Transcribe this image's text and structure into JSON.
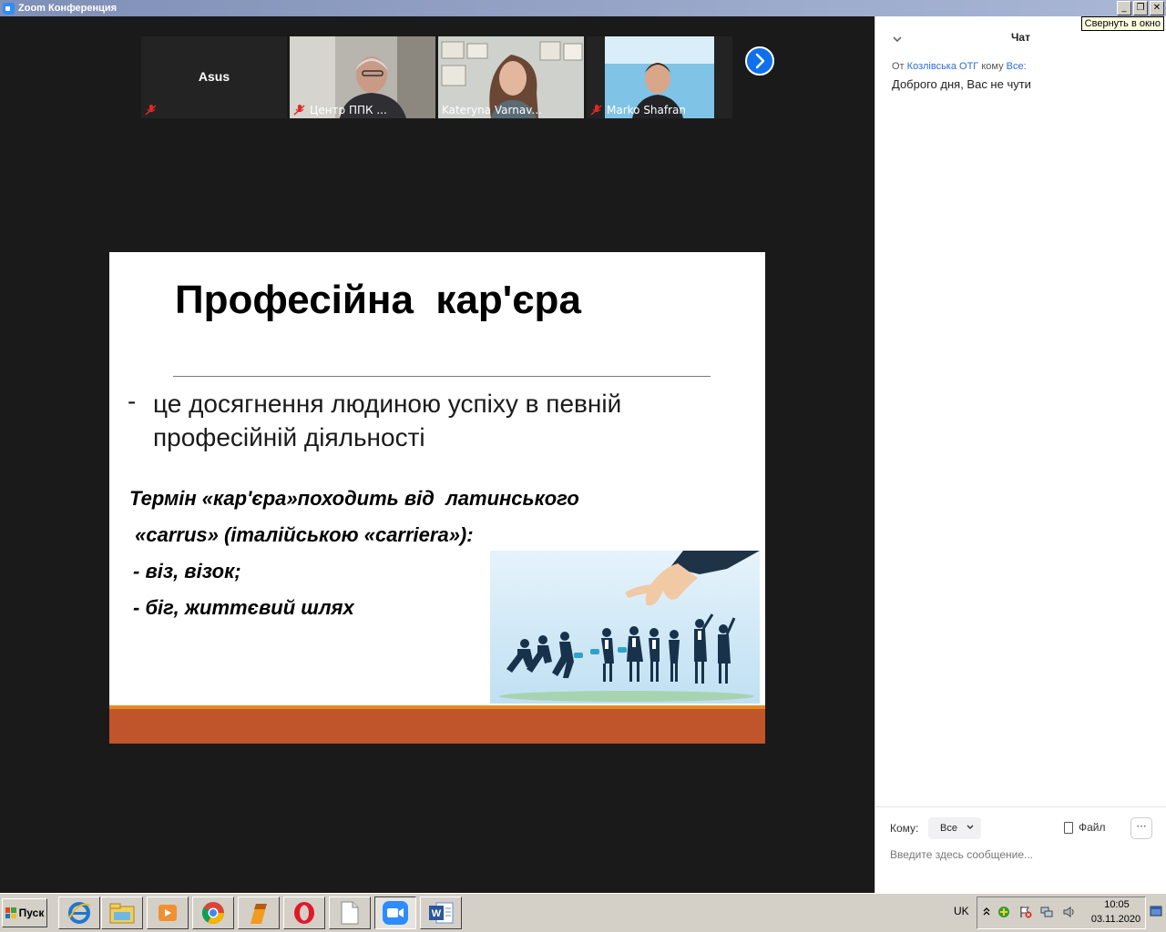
{
  "window": {
    "title": "Zoom Конференция",
    "tooltip": "Свернуть в окно",
    "buttons": [
      "minimize",
      "restore",
      "close"
    ]
  },
  "participants": [
    {
      "name": "Asus",
      "muted": true,
      "video": false
    },
    {
      "name": "Центр ППК ...",
      "muted": true,
      "video": true
    },
    {
      "name": "Kateryna Varnav...",
      "muted": false,
      "video": true,
      "active_speaker": true
    },
    {
      "name": "Marko Shafran",
      "muted": true,
      "video": true
    }
  ],
  "slide": {
    "title": "Професійна  кар'єра",
    "bullet": "-",
    "definition": "це досягнення людиною успіху в певній професійній діяльності",
    "term_line1": "Термін «кар'єра»походить від  латинського",
    "term_line2": " «carrus» (італійською «carriera»):",
    "meaning1": "- віз, візок;",
    "meaning2": "- біг, життєвий шлях",
    "colors": {
      "accent": "#e8891f",
      "bar": "#c0552c"
    }
  },
  "chat": {
    "title": "Чат",
    "from_label": "От",
    "sender": "Козлівська ОТГ",
    "to_label": "кому",
    "recipient": "Все:",
    "message": "Доброго дня, Вас не чути",
    "send_to_label": "Кому:",
    "send_to_value": "Все",
    "file_label": "Файл",
    "input_placeholder": "Введите здесь сообщение..."
  },
  "taskbar": {
    "start_label": "Пуск",
    "apps": [
      "internet-explorer-icon",
      "file-explorer-icon",
      "media-player-icon",
      "chrome-icon",
      "app-icon",
      "opera-icon",
      "document-icon",
      "zoom-icon",
      "word-icon"
    ],
    "language": "UK",
    "time": "10:05",
    "date": "03.11.2020"
  }
}
